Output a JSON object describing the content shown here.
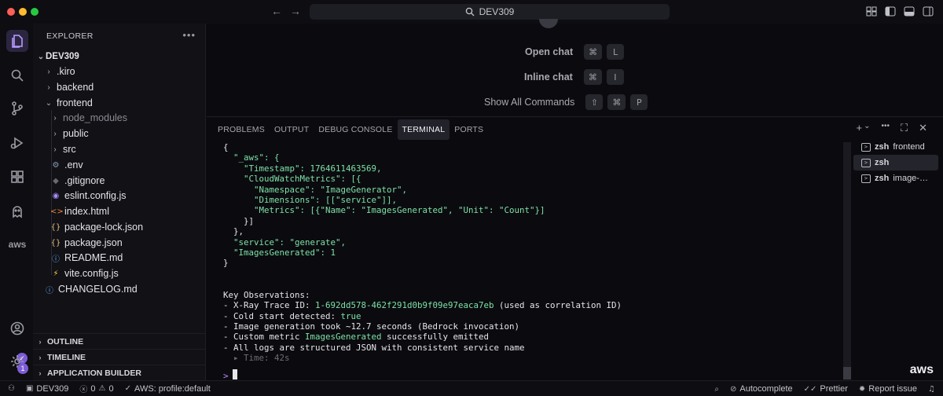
{
  "titlebar": {
    "search_text": "DEV309",
    "back_arrow": "←",
    "forward_arrow": "→"
  },
  "sidebar": {
    "title": "EXPLORER",
    "more": "•••",
    "tree": [
      {
        "label": "DEV309",
        "type": "root",
        "expanded": true
      },
      {
        "label": ".kiro",
        "type": "folder",
        "expanded": false
      },
      {
        "label": "backend",
        "type": "folder",
        "expanded": false
      },
      {
        "label": "frontend",
        "type": "folder",
        "expanded": true
      },
      {
        "label": "node_modules",
        "type": "folder",
        "expanded": false
      },
      {
        "label": "public",
        "type": "folder",
        "expanded": false
      },
      {
        "label": "src",
        "type": "folder",
        "expanded": false
      },
      {
        "label": ".env",
        "type": "file",
        "icon": "gear"
      },
      {
        "label": ".gitignore",
        "type": "file",
        "icon": "git"
      },
      {
        "label": "eslint.config.js",
        "type": "file",
        "icon": "eslint"
      },
      {
        "label": "index.html",
        "type": "file",
        "icon": "html"
      },
      {
        "label": "package-lock.json",
        "type": "file",
        "icon": "json"
      },
      {
        "label": "package.json",
        "type": "file",
        "icon": "json"
      },
      {
        "label": "README.md",
        "type": "file",
        "icon": "info"
      },
      {
        "label": "vite.config.js",
        "type": "file",
        "icon": "vite"
      },
      {
        "label": "CHANGELOG.md",
        "type": "file",
        "icon": "info"
      }
    ],
    "sections": [
      "OUTLINE",
      "TIMELINE",
      "APPLICATION BUILDER"
    ]
  },
  "editor": {
    "commands": [
      {
        "label": "Open chat",
        "keys": [
          "⌘",
          "L"
        ]
      },
      {
        "label": "Inline chat",
        "keys": [
          "⌘",
          "I"
        ]
      },
      {
        "label": "Show All Commands",
        "keys": [
          "⇧",
          "⌘",
          "P"
        ]
      }
    ]
  },
  "panel": {
    "tabs": [
      "PROBLEMS",
      "OUTPUT",
      "DEBUG CONSOLE",
      "TERMINAL",
      "PORTS"
    ],
    "active_tab": "TERMINAL",
    "actions": [
      "+",
      "⌄",
      "•••",
      "⛶",
      "✕"
    ]
  },
  "terminal": {
    "json": {
      "open": "{",
      "aws_key": "\"_aws\": {",
      "timestamp_key": "\"Timestamp\": ",
      "timestamp_val": "1764611463569,",
      "cwm_key": "\"CloudWatchMetrics\": [{",
      "ns_line": "\"Namespace\": \"ImageGenerator\",",
      "dim_line": "\"Dimensions\": [[\"service\"]],",
      "metrics_line": "\"Metrics\": [{\"Name\": \"ImagesGenerated\", \"Unit\": \"Count\"}]",
      "close_obj": "}]",
      "close_aws": "},",
      "service_line": "\"service\": \"generate\",",
      "images_key": "\"ImagesGenerated\": ",
      "images_val": "1",
      "close": "}"
    },
    "observations_title": "Key Observations:",
    "obs": {
      "l1_pre": "- X-Ray Trace ID: ",
      "l1_hl": "1-692dd578-462f291d0b9f09e97eaca7eb",
      "l1_post": " (used as correlation ID)",
      "l2_pre": "- Cold start detected: ",
      "l2_hl": "true",
      "l3": "- Image generation took ~12.7 seconds (Bedrock invocation)",
      "l4_pre": "- Custom metric ",
      "l4_hl": "ImagesGenerated",
      "l4_post": " successfully emitted",
      "l5": "- All logs are structured JSON with consistent service name",
      "l6": "▸ Time: 42s"
    },
    "prompt": ">",
    "sessions": [
      {
        "shell": "zsh",
        "name": "frontend",
        "active": false
      },
      {
        "shell": "zsh",
        "name": "",
        "active": true
      },
      {
        "shell": "zsh",
        "name": "image-…",
        "active": false
      }
    ],
    "aws_logo": "aws"
  },
  "statusbar": {
    "workspace": "DEV309",
    "errors": "0",
    "warnings": "0",
    "profile": "AWS: profile:default",
    "autocomplete": "Autocomplete",
    "prettier": "Prettier",
    "report": "Report issue"
  },
  "activity": {
    "settings_badge": "1",
    "account_badge": "✓",
    "aws_label": "aws"
  }
}
